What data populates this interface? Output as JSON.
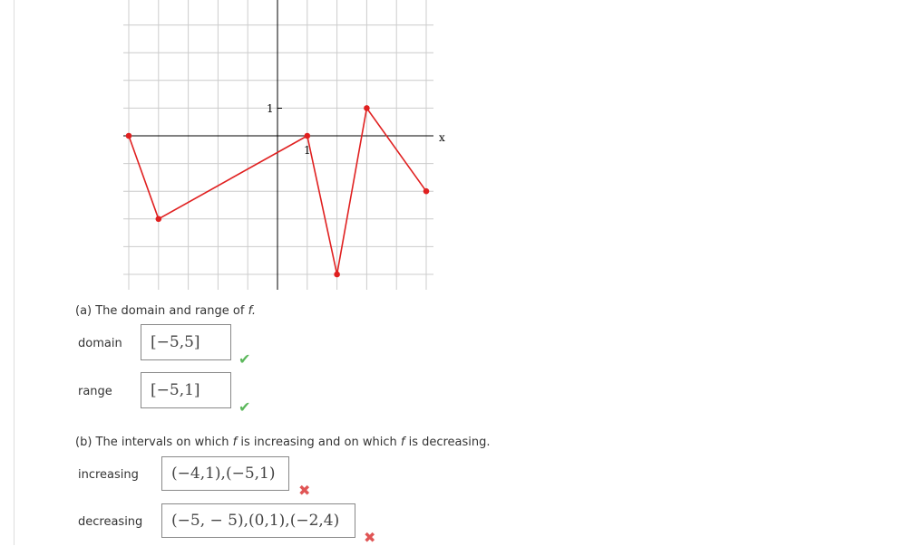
{
  "graph": {
    "x_axis_label": "x",
    "x_tick_label": "1",
    "y_tick_label": "1",
    "line_color": "#e02020",
    "points": [
      [
        -5,
        0
      ],
      [
        -4,
        -3
      ],
      [
        1,
        0
      ],
      [
        2,
        -5
      ],
      [
        3,
        1
      ],
      [
        5,
        -2
      ]
    ],
    "x_range": [
      -5,
      5
    ],
    "y_range": [
      -5,
      5
    ],
    "grid": true
  },
  "part_a": {
    "prompt": "(a) The domain and range of",
    "fn": "f.",
    "domain_label": "domain",
    "domain_value": "[−5,5]",
    "domain_status": "correct",
    "range_label": "range",
    "range_value": "[−5,1]",
    "range_status": "correct"
  },
  "part_b": {
    "prompt_1": "(b) The intervals on which",
    "fn": "f",
    "prompt_2": "is increasing and on which",
    "prompt_3": "is decreasing.",
    "increasing_label": "increasing",
    "increasing_value": "(−4,1),(−5,1)",
    "increasing_status": "incorrect",
    "decreasing_label": "decreasing",
    "decreasing_value": "(−5, − 5),(0,1),(−2,4)",
    "decreasing_status": "incorrect"
  },
  "icons": {
    "correct": "✔",
    "incorrect": "✖"
  }
}
